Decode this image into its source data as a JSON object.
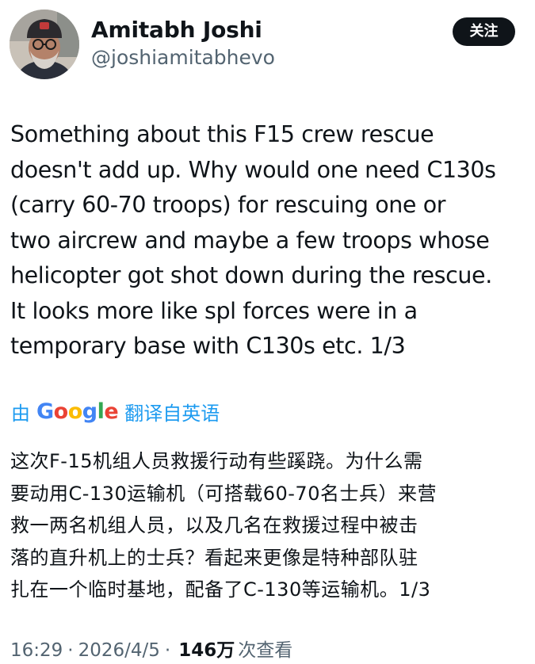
{
  "author": {
    "display_name": "Amitabh Joshi",
    "handle": "@joshiamitabhevo",
    "avatar_icon": "user-avatar"
  },
  "follow_button": {
    "label": "关注"
  },
  "tweet": {
    "text": "Something about this F15 crew rescue\ndoesn't add up. Why would one need C130s\n(carry 60-70 troops) for rescuing one or\ntwo aircrew and maybe a few troops whose\nhelicopter got shot down during the rescue.\nIt looks more like spl forces were in a\ntemporary base with C130s etc. 1/3"
  },
  "translation": {
    "prefix": "由",
    "provider": "Google",
    "link_label": "翻译自英语",
    "text": "这次F-15机组人员救援行动有些蹊跷。为什么需\n要动用C-130运输机（可搭载60-70名士兵）来营\n救一两名机组人员，以及几名在救援过程中被击\n落的直升机上的士兵？看起来更像是特种部队驻\n扎在一个临时基地，配备了C-130等运输机。1/3"
  },
  "meta": {
    "time": "16:29",
    "separator": "·",
    "date": "2026/4/5",
    "views_count": "146万",
    "views_label": "次查看"
  },
  "colors": {
    "link": "#1d9bf0",
    "text": "#0f1419",
    "muted": "#536471",
    "google_blue": "#4285f4",
    "google_red": "#ea4335",
    "google_yellow": "#fbbc05",
    "google_green": "#34a853"
  }
}
